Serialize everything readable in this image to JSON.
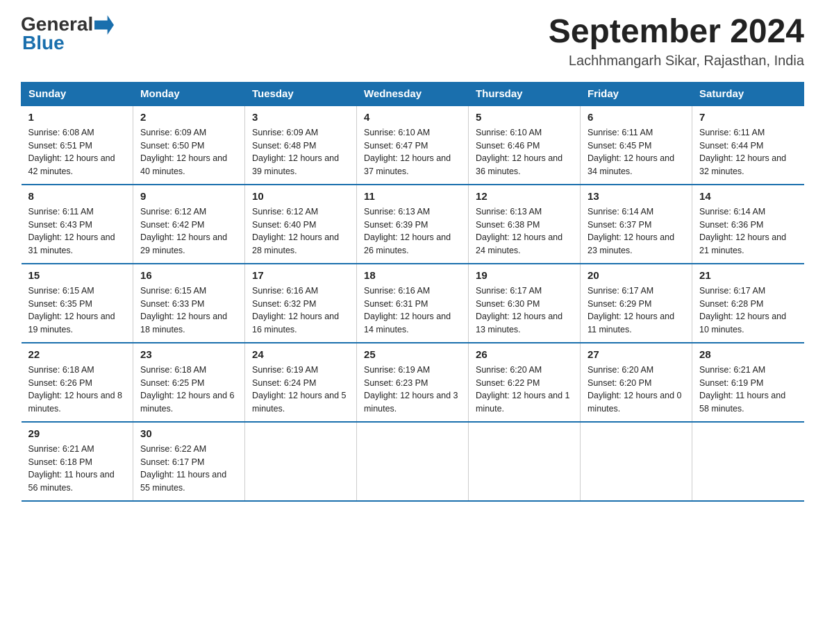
{
  "header": {
    "logo_general": "General",
    "logo_blue": "Blue",
    "month_year": "September 2024",
    "location": "Lachhmangarh Sikar, Rajasthan, India"
  },
  "days_of_week": [
    "Sunday",
    "Monday",
    "Tuesday",
    "Wednesday",
    "Thursday",
    "Friday",
    "Saturday"
  ],
  "weeks": [
    [
      {
        "day": "1",
        "sunrise": "6:08 AM",
        "sunset": "6:51 PM",
        "daylight": "12 hours and 42 minutes."
      },
      {
        "day": "2",
        "sunrise": "6:09 AM",
        "sunset": "6:50 PM",
        "daylight": "12 hours and 40 minutes."
      },
      {
        "day": "3",
        "sunrise": "6:09 AM",
        "sunset": "6:48 PM",
        "daylight": "12 hours and 39 minutes."
      },
      {
        "day": "4",
        "sunrise": "6:10 AM",
        "sunset": "6:47 PM",
        "daylight": "12 hours and 37 minutes."
      },
      {
        "day": "5",
        "sunrise": "6:10 AM",
        "sunset": "6:46 PM",
        "daylight": "12 hours and 36 minutes."
      },
      {
        "day": "6",
        "sunrise": "6:11 AM",
        "sunset": "6:45 PM",
        "daylight": "12 hours and 34 minutes."
      },
      {
        "day": "7",
        "sunrise": "6:11 AM",
        "sunset": "6:44 PM",
        "daylight": "12 hours and 32 minutes."
      }
    ],
    [
      {
        "day": "8",
        "sunrise": "6:11 AM",
        "sunset": "6:43 PM",
        "daylight": "12 hours and 31 minutes."
      },
      {
        "day": "9",
        "sunrise": "6:12 AM",
        "sunset": "6:42 PM",
        "daylight": "12 hours and 29 minutes."
      },
      {
        "day": "10",
        "sunrise": "6:12 AM",
        "sunset": "6:40 PM",
        "daylight": "12 hours and 28 minutes."
      },
      {
        "day": "11",
        "sunrise": "6:13 AM",
        "sunset": "6:39 PM",
        "daylight": "12 hours and 26 minutes."
      },
      {
        "day": "12",
        "sunrise": "6:13 AM",
        "sunset": "6:38 PM",
        "daylight": "12 hours and 24 minutes."
      },
      {
        "day": "13",
        "sunrise": "6:14 AM",
        "sunset": "6:37 PM",
        "daylight": "12 hours and 23 minutes."
      },
      {
        "day": "14",
        "sunrise": "6:14 AM",
        "sunset": "6:36 PM",
        "daylight": "12 hours and 21 minutes."
      }
    ],
    [
      {
        "day": "15",
        "sunrise": "6:15 AM",
        "sunset": "6:35 PM",
        "daylight": "12 hours and 19 minutes."
      },
      {
        "day": "16",
        "sunrise": "6:15 AM",
        "sunset": "6:33 PM",
        "daylight": "12 hours and 18 minutes."
      },
      {
        "day": "17",
        "sunrise": "6:16 AM",
        "sunset": "6:32 PM",
        "daylight": "12 hours and 16 minutes."
      },
      {
        "day": "18",
        "sunrise": "6:16 AM",
        "sunset": "6:31 PM",
        "daylight": "12 hours and 14 minutes."
      },
      {
        "day": "19",
        "sunrise": "6:17 AM",
        "sunset": "6:30 PM",
        "daylight": "12 hours and 13 minutes."
      },
      {
        "day": "20",
        "sunrise": "6:17 AM",
        "sunset": "6:29 PM",
        "daylight": "12 hours and 11 minutes."
      },
      {
        "day": "21",
        "sunrise": "6:17 AM",
        "sunset": "6:28 PM",
        "daylight": "12 hours and 10 minutes."
      }
    ],
    [
      {
        "day": "22",
        "sunrise": "6:18 AM",
        "sunset": "6:26 PM",
        "daylight": "12 hours and 8 minutes."
      },
      {
        "day": "23",
        "sunrise": "6:18 AM",
        "sunset": "6:25 PM",
        "daylight": "12 hours and 6 minutes."
      },
      {
        "day": "24",
        "sunrise": "6:19 AM",
        "sunset": "6:24 PM",
        "daylight": "12 hours and 5 minutes."
      },
      {
        "day": "25",
        "sunrise": "6:19 AM",
        "sunset": "6:23 PM",
        "daylight": "12 hours and 3 minutes."
      },
      {
        "day": "26",
        "sunrise": "6:20 AM",
        "sunset": "6:22 PM",
        "daylight": "12 hours and 1 minute."
      },
      {
        "day": "27",
        "sunrise": "6:20 AM",
        "sunset": "6:20 PM",
        "daylight": "12 hours and 0 minutes."
      },
      {
        "day": "28",
        "sunrise": "6:21 AM",
        "sunset": "6:19 PM",
        "daylight": "11 hours and 58 minutes."
      }
    ],
    [
      {
        "day": "29",
        "sunrise": "6:21 AM",
        "sunset": "6:18 PM",
        "daylight": "11 hours and 56 minutes."
      },
      {
        "day": "30",
        "sunrise": "6:22 AM",
        "sunset": "6:17 PM",
        "daylight": "11 hours and 55 minutes."
      },
      null,
      null,
      null,
      null,
      null
    ]
  ]
}
